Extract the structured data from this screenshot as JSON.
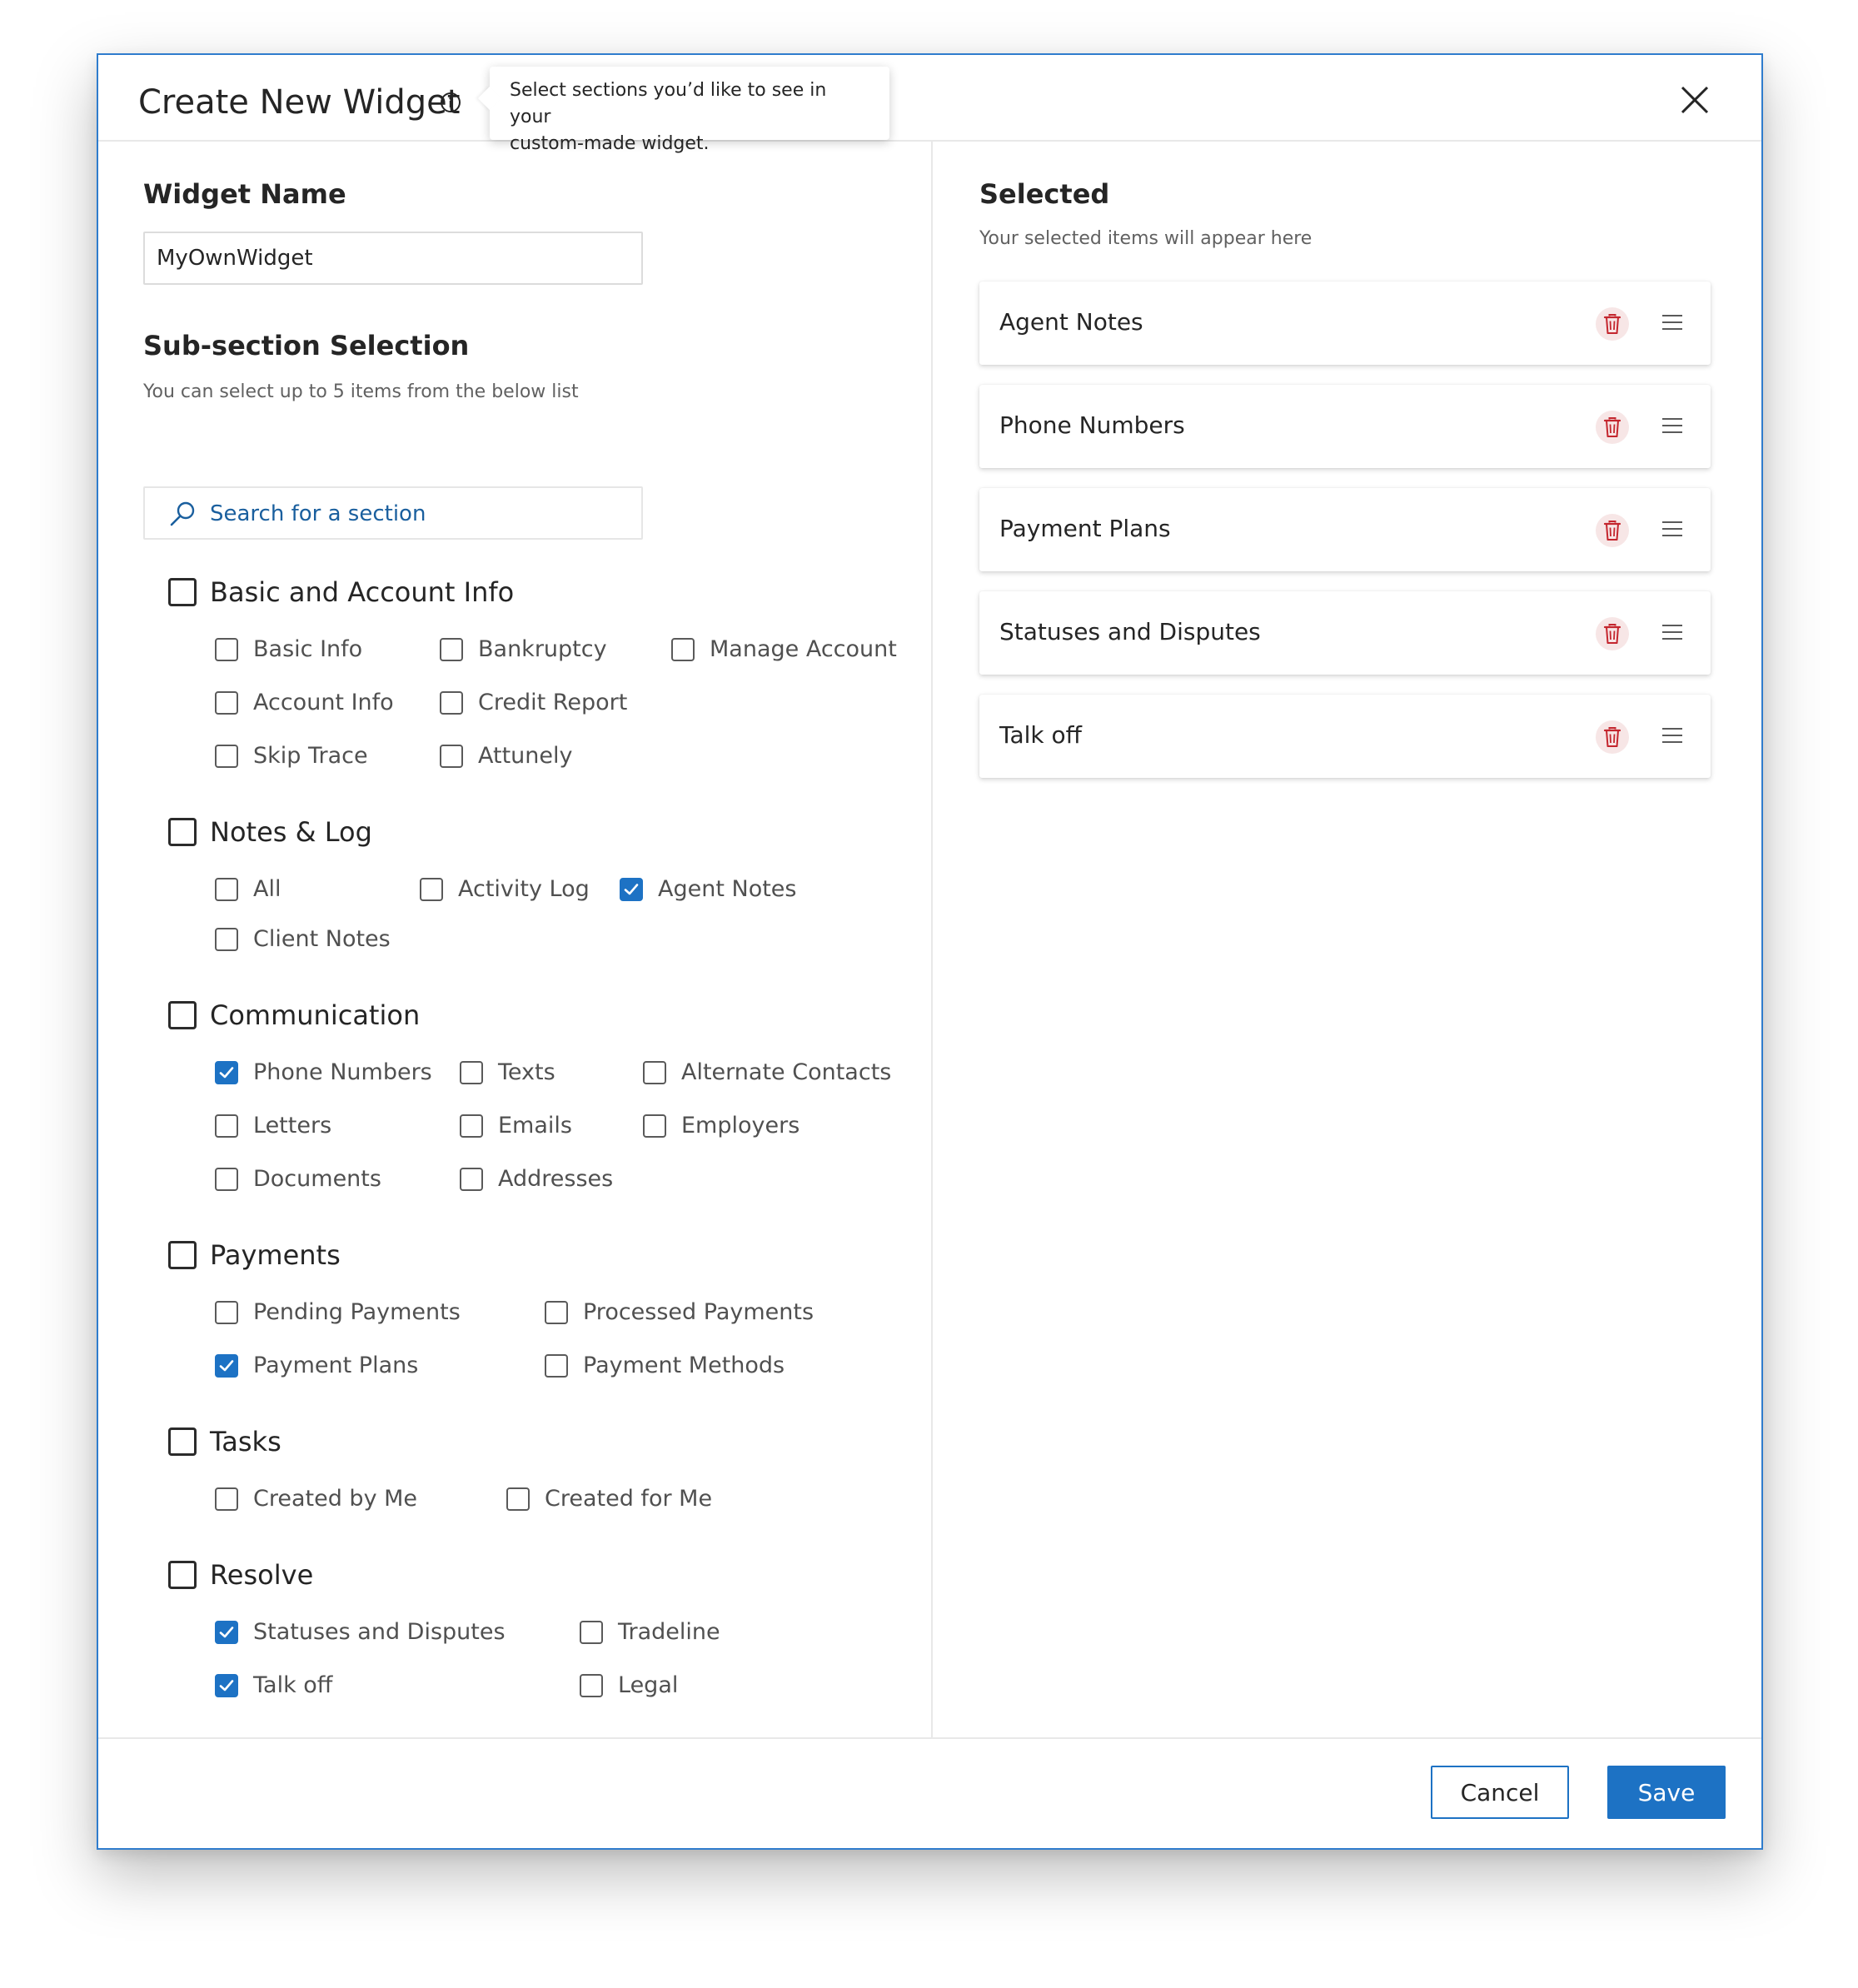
{
  "dialog": {
    "title": "Create New Widget",
    "tooltip": [
      "Select sections you’d like to see in your",
      "custom-made widget."
    ]
  },
  "widget_name": {
    "label": "Widget Name",
    "value": "MyOwnWidget"
  },
  "subsection": {
    "title": "Sub-section Selection",
    "hint": "You can select up to 5 items from the below list",
    "search_placeholder": "Search for a section"
  },
  "groups": [
    {
      "label": "Basic and Account Info",
      "checked": false,
      "items": [
        {
          "label": "Basic Info",
          "checked": false
        },
        {
          "label": "Bankruptcy",
          "checked": false
        },
        {
          "label": "Manage Account",
          "checked": false
        },
        {
          "label": "Account Info",
          "checked": false
        },
        {
          "label": "Credit Report",
          "checked": false
        },
        {
          "label": "Skip Trace",
          "checked": false
        },
        {
          "label": "Attunely",
          "checked": false
        }
      ]
    },
    {
      "label": "Notes & Log",
      "checked": false,
      "items": [
        {
          "label": "All",
          "checked": false
        },
        {
          "label": "Activity Log",
          "checked": false
        },
        {
          "label": "Agent Notes",
          "checked": true
        },
        {
          "label": "Client Notes",
          "checked": false
        }
      ]
    },
    {
      "label": "Communication",
      "checked": false,
      "items": [
        {
          "label": "Phone Numbers",
          "checked": true
        },
        {
          "label": "Texts",
          "checked": false
        },
        {
          "label": "Alternate Contacts",
          "checked": false
        },
        {
          "label": "Letters",
          "checked": false
        },
        {
          "label": "Emails",
          "checked": false
        },
        {
          "label": "Employers",
          "checked": false
        },
        {
          "label": "Documents",
          "checked": false
        },
        {
          "label": "Addresses",
          "checked": false
        }
      ]
    },
    {
      "label": "Payments",
      "checked": false,
      "items": [
        {
          "label": "Pending Payments",
          "checked": false
        },
        {
          "label": "Processed Payments",
          "checked": false
        },
        {
          "label": "Payment Plans",
          "checked": true
        },
        {
          "label": "Payment Methods",
          "checked": false
        }
      ]
    },
    {
      "label": "Tasks",
      "checked": false,
      "items": [
        {
          "label": "Created by Me",
          "checked": false
        },
        {
          "label": "Created for Me",
          "checked": false
        }
      ]
    },
    {
      "label": "Resolve",
      "checked": false,
      "items": [
        {
          "label": "Statuses and Disputes",
          "checked": true
        },
        {
          "label": "Tradeline",
          "checked": false
        },
        {
          "label": "Talk off",
          "checked": true
        },
        {
          "label": "Legal",
          "checked": false
        }
      ]
    }
  ],
  "selected": {
    "title": "Selected",
    "hint": "Your selected items will appear here",
    "items": [
      "Agent Notes",
      "Phone Numbers",
      "Payment Plans",
      "Statuses and Disputes",
      "Talk off"
    ]
  },
  "footer": {
    "cancel_label": "Cancel",
    "save_label": "Save"
  },
  "colors": {
    "accent": "#1d72c4",
    "dialog_border": "#2f7ccd",
    "delete_icon": "#c4262e",
    "delete_icon_bg": "#f7e6e6"
  },
  "icons": {
    "info": "info-icon",
    "close": "close-icon",
    "search": "search-icon",
    "delete": "trash-icon",
    "reorder": "drag-handle-icon",
    "check": "checkmark-icon"
  }
}
